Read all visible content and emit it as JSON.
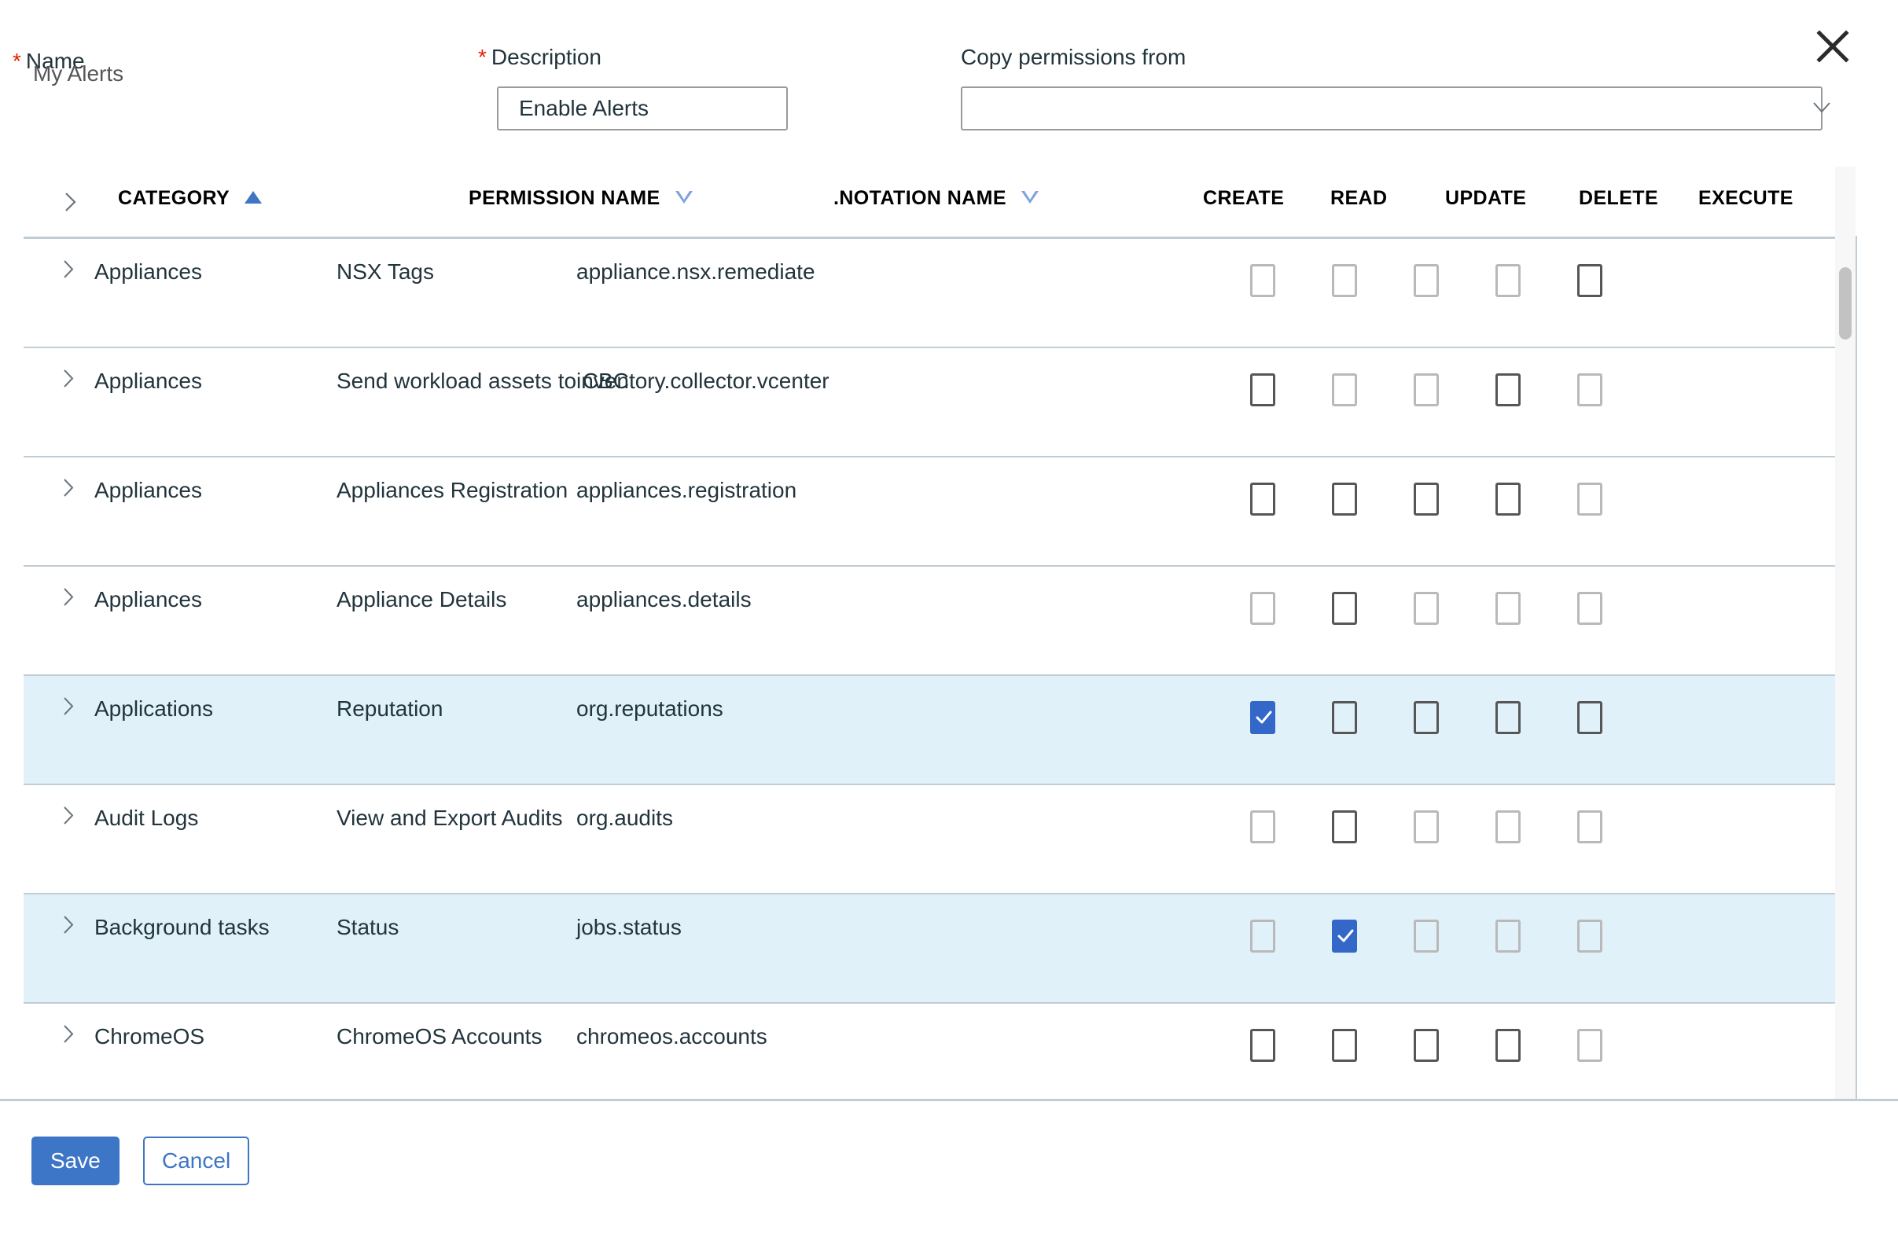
{
  "form": {
    "name_label": "Name",
    "name_value": "My Alerts",
    "name_required": "*",
    "description_label": "Description",
    "description_required": "*",
    "description_value": "Enable Alerts",
    "copy_label": "Copy permissions from",
    "copy_value": "",
    "copy_placeholder": ""
  },
  "close_label": "",
  "table": {
    "headers": {
      "category": "CATEGORY",
      "permission_name": "PERMISSION NAME",
      "notation_name": ".NOTATION NAME",
      "create": "CREATE",
      "read": "READ",
      "update": "UPDATE",
      "delete": "DELETE",
      "execute": "EXECUTE"
    },
    "sort": {
      "category": "ascending",
      "permission_name": "descending",
      "notation_name": "descending"
    },
    "rows": [
      {
        "category": "Appliances",
        "permission": "NSX Tags",
        "notation": "appliance.nsx.remediate",
        "selected": false,
        "perms": [
          {
            "key": "create",
            "enabled": false,
            "checked": false
          },
          {
            "key": "read",
            "enabled": false,
            "checked": false
          },
          {
            "key": "update",
            "enabled": false,
            "checked": false
          },
          {
            "key": "delete",
            "enabled": false,
            "checked": false
          },
          {
            "key": "execute",
            "enabled": true,
            "checked": false
          }
        ]
      },
      {
        "category": "Appliances",
        "permission": "Send workload assets to CBC",
        "notation": "inventory.collector.vcenter",
        "selected": false,
        "perms": [
          {
            "key": "create",
            "enabled": true,
            "checked": false
          },
          {
            "key": "read",
            "enabled": false,
            "checked": false
          },
          {
            "key": "update",
            "enabled": false,
            "checked": false
          },
          {
            "key": "delete",
            "enabled": true,
            "checked": false
          },
          {
            "key": "execute",
            "enabled": false,
            "checked": false
          }
        ]
      },
      {
        "category": "Appliances",
        "permission": "Appliances Registration",
        "notation": "appliances.registration",
        "selected": false,
        "perms": [
          {
            "key": "create",
            "enabled": true,
            "checked": false
          },
          {
            "key": "read",
            "enabled": true,
            "checked": false
          },
          {
            "key": "update",
            "enabled": true,
            "checked": false
          },
          {
            "key": "delete",
            "enabled": true,
            "checked": false
          },
          {
            "key": "execute",
            "enabled": false,
            "checked": false
          }
        ]
      },
      {
        "category": "Appliances",
        "permission": "Appliance Details",
        "notation": "appliances.details",
        "selected": false,
        "perms": [
          {
            "key": "create",
            "enabled": false,
            "checked": false
          },
          {
            "key": "read",
            "enabled": true,
            "checked": false
          },
          {
            "key": "update",
            "enabled": false,
            "checked": false
          },
          {
            "key": "delete",
            "enabled": false,
            "checked": false
          },
          {
            "key": "execute",
            "enabled": false,
            "checked": false
          }
        ]
      },
      {
        "category": "Applications",
        "permission": "Reputation",
        "notation": "org.reputations",
        "selected": true,
        "perms": [
          {
            "key": "create",
            "enabled": true,
            "checked": true
          },
          {
            "key": "read",
            "enabled": true,
            "checked": false
          },
          {
            "key": "update",
            "enabled": true,
            "checked": false
          },
          {
            "key": "delete",
            "enabled": true,
            "checked": false
          },
          {
            "key": "execute",
            "enabled": true,
            "checked": false
          }
        ]
      },
      {
        "category": "Audit Logs",
        "permission": "View and Export Audits",
        "notation": "org.audits",
        "selected": false,
        "perms": [
          {
            "key": "create",
            "enabled": false,
            "checked": false
          },
          {
            "key": "read",
            "enabled": true,
            "checked": false
          },
          {
            "key": "update",
            "enabled": false,
            "checked": false
          },
          {
            "key": "delete",
            "enabled": false,
            "checked": false
          },
          {
            "key": "execute",
            "enabled": false,
            "checked": false
          }
        ]
      },
      {
        "category": "Background tasks",
        "permission": "Status",
        "notation": "jobs.status",
        "selected": true,
        "perms": [
          {
            "key": "create",
            "enabled": false,
            "checked": false
          },
          {
            "key": "read",
            "enabled": true,
            "checked": true
          },
          {
            "key": "update",
            "enabled": false,
            "checked": false
          },
          {
            "key": "delete",
            "enabled": false,
            "checked": false
          },
          {
            "key": "execute",
            "enabled": false,
            "checked": false
          }
        ]
      },
      {
        "category": "ChromeOS",
        "permission": "ChromeOS Accounts",
        "notation": "chromeos.accounts",
        "selected": false,
        "perms": [
          {
            "key": "create",
            "enabled": true,
            "checked": false
          },
          {
            "key": "read",
            "enabled": true,
            "checked": false
          },
          {
            "key": "update",
            "enabled": true,
            "checked": false
          },
          {
            "key": "delete",
            "enabled": true,
            "checked": false
          },
          {
            "key": "execute",
            "enabled": false,
            "checked": false
          }
        ]
      }
    ]
  },
  "footer": {
    "save_label": "Save",
    "cancel_label": "Cancel"
  },
  "colors": {
    "accent": "#3d75c7",
    "checked": "#3468c8",
    "row_selected": "#e1f1fa",
    "required": "#e02200",
    "border": "#c1cdd4",
    "sort_active": "#4274c6"
  },
  "layout": {
    "perm_columns": [
      "create",
      "read",
      "update",
      "delete",
      "execute"
    ],
    "header_x": [
      1543,
      1650,
      1760,
      1870,
      1975
    ],
    "checkbox_x": [
      1590,
      1694,
      1798,
      1902,
      2006
    ]
  }
}
